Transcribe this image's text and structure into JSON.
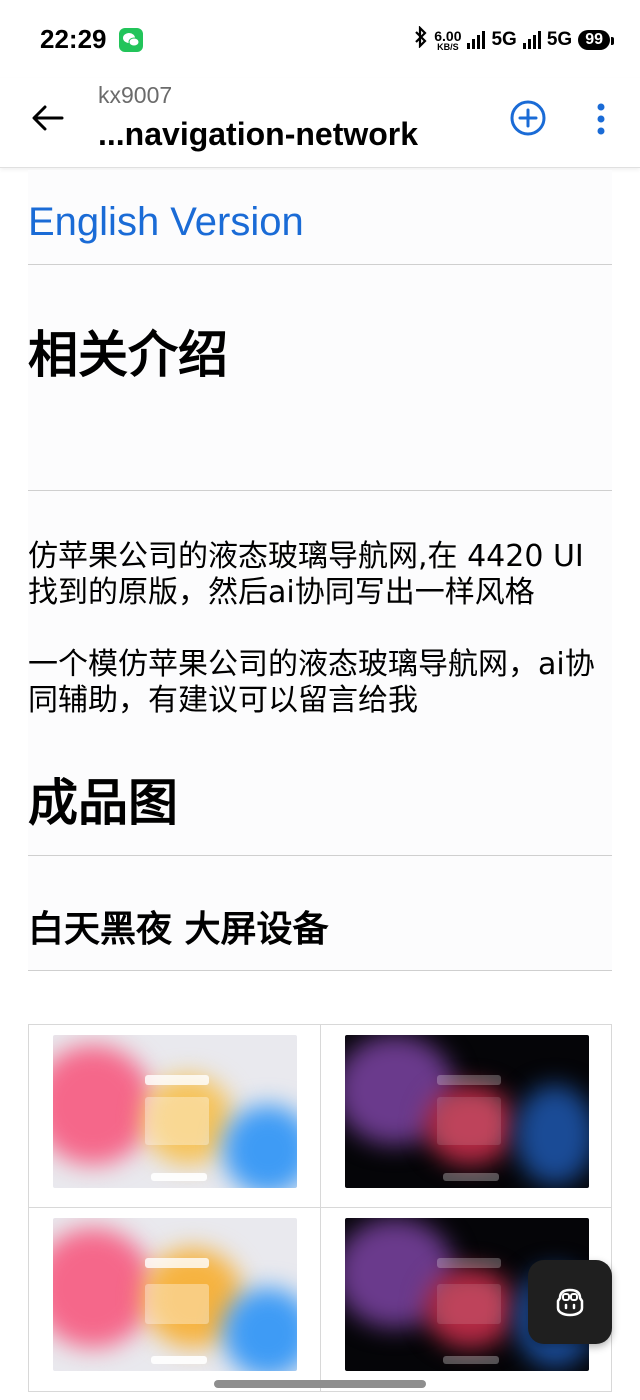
{
  "status": {
    "time": "22:29",
    "net_speed_value": "6.00",
    "net_speed_unit": "KB/S",
    "network1": "5G",
    "network2": "5G",
    "battery": "99"
  },
  "app_bar": {
    "owner": "kx9007",
    "repo": "...navigation-network"
  },
  "readme": {
    "english_link": "English Version",
    "heading_intro": "相关介绍",
    "para1": "仿苹果公司的液态玻璃导航网,在 4420 UI找到的原版，然后ai协同写出一样风格",
    "para2": "一个模仿苹果公司的液态玻璃导航网，ai协同辅助，有建议可以留言给我",
    "heading_result": "成品图",
    "subheading": "白天黑夜 大屏设备"
  },
  "gallery": {
    "items": [
      {
        "theme": "light"
      },
      {
        "theme": "dark"
      },
      {
        "theme": "light"
      },
      {
        "theme": "dark"
      }
    ]
  },
  "colors": {
    "link": "#1a6bd6",
    "accent": "#1a6bd6",
    "wechat": "#22c45a"
  }
}
